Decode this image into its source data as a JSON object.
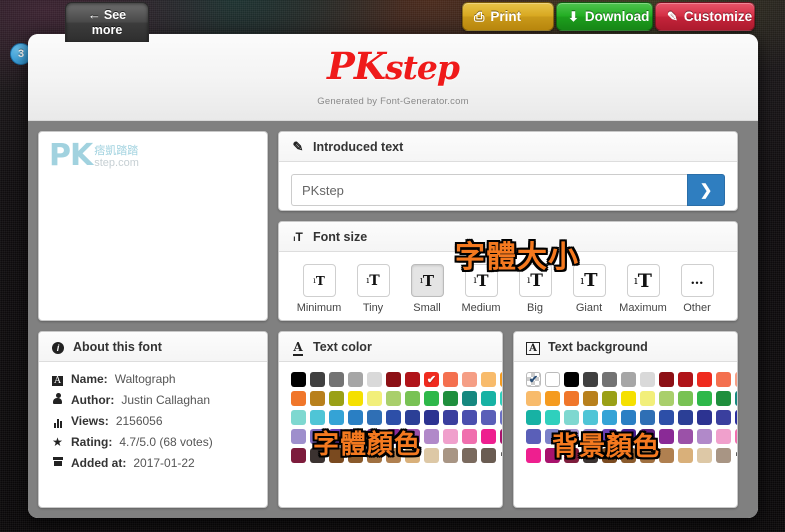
{
  "toolbar": {
    "see_more_line1": "See",
    "see_more_line2": "more",
    "see_more_arrow": "←",
    "badge_count": "3",
    "print_label": "Print",
    "print_icon": "printer-icon",
    "print_glyph": "⎙",
    "download_label": "Download",
    "download_glyph": "⬇",
    "customize_label": "Customize",
    "customize_glyph": "✎"
  },
  "header": {
    "logo_text_pk": "PK",
    "logo_text_step": "step",
    "generated_by": "Generated by Font-Generator.com",
    "logo_color": "#ef1a1a"
  },
  "preview": {
    "watermark_pk": "PK",
    "watermark_cn": "痞凱踏踏",
    "watermark_domain": "step.com"
  },
  "introduced": {
    "title": "Introduced text",
    "icon": "edit-square-icon",
    "icon_glyph": "✎",
    "value": "PKstep",
    "placeholder": "PKstep",
    "go_glyph": "❯"
  },
  "fontsize": {
    "title": "Font size",
    "icon": "font-size-icon",
    "icon_glyph": "T",
    "overlay_cn": "字體大小",
    "selected": "Small",
    "options": [
      {
        "label": "Minimum",
        "glyph_small": "ı",
        "glyph_big": "T",
        "size_small": 8,
        "size_big": 12
      },
      {
        "label": "Tiny",
        "glyph_small": "ı",
        "glyph_big": "T",
        "size_small": 9,
        "size_big": 14
      },
      {
        "label": "Small",
        "glyph_small": "ı",
        "glyph_big": "T",
        "size_small": 9,
        "size_big": 15
      },
      {
        "label": "Medium",
        "glyph_small": "ı",
        "glyph_big": "T",
        "size_small": 10,
        "size_big": 16
      },
      {
        "label": "Big",
        "glyph_small": "ı",
        "glyph_big": "T",
        "size_small": 10,
        "size_big": 17
      },
      {
        "label": "Giant",
        "glyph_small": "ı",
        "glyph_big": "T",
        "size_small": 11,
        "size_big": 18
      },
      {
        "label": "Maximum",
        "glyph_small": "ı",
        "glyph_big": "T",
        "size_small": 11,
        "size_big": 19
      },
      {
        "label": "Other",
        "glyph_small": "",
        "glyph_big": "…",
        "size_small": 0,
        "size_big": 13
      }
    ]
  },
  "about": {
    "title": "About this font",
    "icon": "info-circle-icon",
    "icon_glyph": "ℹ",
    "rows": [
      {
        "icon": "font-letter-icon",
        "glyph": "A",
        "label": "Name:",
        "value": "Waltograph"
      },
      {
        "icon": "user-icon",
        "glyph": "♟",
        "label": "Author:",
        "value": "Justin Callaghan"
      },
      {
        "icon": "bar-chart-icon",
        "glyph": "‖",
        "label": "Views:",
        "value": "2156056"
      },
      {
        "icon": "star-icon",
        "glyph": "★",
        "label": "Rating:",
        "value": "4.7/5.0 (68 votes)"
      },
      {
        "icon": "calendar-icon",
        "glyph": "▦",
        "label": "Added at:",
        "value": "2017-01-22"
      }
    ]
  },
  "textcolor": {
    "title": "Text color",
    "icon": "underlined-a-icon",
    "icon_glyph": "A",
    "overlay_cn": "字體顏色",
    "selected_index": 7,
    "plus_glyph": "✚",
    "rows": [
      [
        "#000000",
        "#404040",
        "#737373",
        "#a6a6a6",
        "#d9d9d9",
        "#8c1015",
        "#b01419",
        "#ef2b1f",
        "#f4704f",
        "#f59e85",
        "#f8bb6b",
        "#f59b1f"
      ],
      [
        "#f0762a",
        "#b8801c",
        "#9aa016",
        "#f5e000",
        "#f2ef7a",
        "#a9cf6b",
        "#78c254",
        "#2eb84a",
        "#1f8f3d",
        "#16887f",
        "#17b2a4",
        "#2fd0bd"
      ],
      [
        "#7ed8d0",
        "#4fc5d6",
        "#34a3d6",
        "#2a7fc4",
        "#2f6fb5",
        "#2d4fa8",
        "#2b3f96",
        "#2c3391",
        "#3a3f9e",
        "#4a4fae",
        "#5a5fb8",
        "#6c70c4"
      ],
      [
        "#9e8fcc",
        "#7e6bbf",
        "#6b3fb5",
        "#4b1f8f",
        "#5b1f7a",
        "#8a2a96",
        "#9b51a8",
        "#b189c9",
        "#f0a0cc",
        "#f06fae",
        "#ee1f8f",
        "#a8126d"
      ],
      [
        "#7d1c3c",
        "#3b3230",
        "#7a4a1f",
        "#8a5a2b",
        "#a07040",
        "#b08050",
        "#d9b07a",
        "#ddc8a6",
        "#a89584",
        "#7a6a5e",
        "#6a5c52"
      ]
    ]
  },
  "textbg": {
    "title": "Text background",
    "icon": "framed-a-icon",
    "icon_glyph": "A",
    "overlay_cn": "背景顏色",
    "selected_index": 0,
    "plus_glyph": "✚",
    "rows": [
      [
        "transparent",
        "#ffffff",
        "#000000",
        "#404040",
        "#737373",
        "#a6a6a6",
        "#d9d9d9",
        "#8c1015",
        "#b01419",
        "#ef2b1f",
        "#f4704f",
        "#f59e85"
      ],
      [
        "#f8bb6b",
        "#f59b1f",
        "#f0762a",
        "#b8801c",
        "#9aa016",
        "#f5e000",
        "#f2ef7a",
        "#a9cf6b",
        "#78c254",
        "#2eb84a",
        "#1f8f3d",
        "#16887f"
      ],
      [
        "#17b2a4",
        "#2fd0bd",
        "#7ed8d0",
        "#4fc5d6",
        "#34a3d6",
        "#2a7fc4",
        "#2f6fb5",
        "#2d4fa8",
        "#2b3f96",
        "#2c3391",
        "#3a3f9e",
        "#2b2f9e"
      ],
      [
        "#5a5fb8",
        "#7b81c9",
        "#9e8fcc",
        "#8e78c4",
        "#6b3fb5",
        "#4b1f8f",
        "#5b1f7a",
        "#8a2a96",
        "#9b51a8",
        "#b189c9",
        "#f0a0cc",
        "#f06fae"
      ],
      [
        "#ee1f8f",
        "#a8126d",
        "#7d1c3c",
        "#3b3230",
        "#7a4a1f",
        "#8a5a2b",
        "#a07040",
        "#b08050",
        "#d9b07a",
        "#ddc8a6",
        "#a89584"
      ]
    ]
  }
}
